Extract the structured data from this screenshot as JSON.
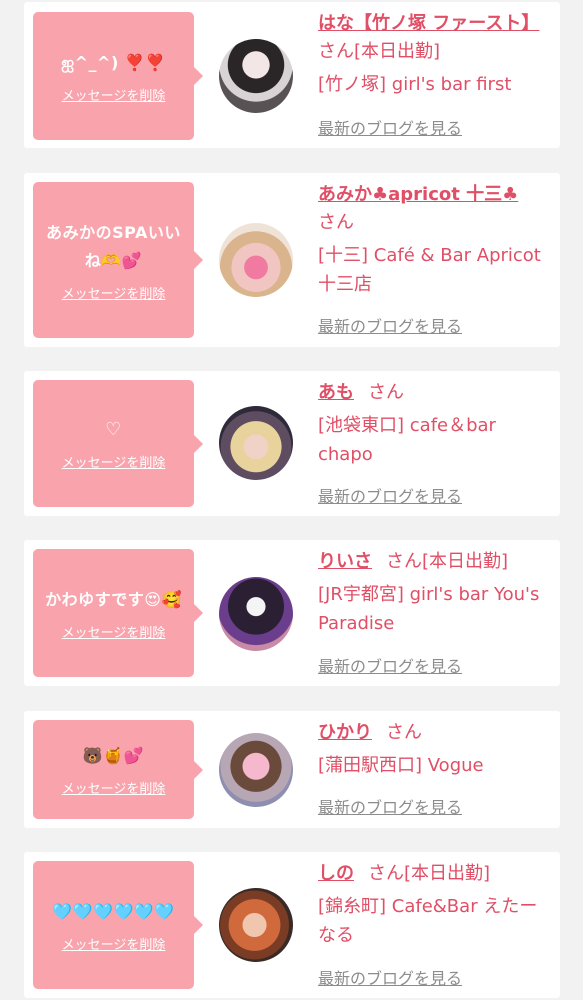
{
  "ui": {
    "delete_label": "メッセージを削除",
    "blog_label": "最新のブログを見る",
    "san": "さん",
    "accent_color": "#e04f66",
    "bubble_color": "#f9a4ad"
  },
  "cards": [
    {
      "message": "ஐ^_^) ❣️❣️",
      "name": "はな【竹ノ塚 ファースト】",
      "status": "[本日出勤]",
      "shop": "[竹ノ塚] girl's bar first"
    },
    {
      "message": "あみかのSPAいいね🫶💕",
      "name": "あみか♣apricot 十三♣",
      "status": "",
      "shop": "[十三] Café & Bar Apricot 十三店"
    },
    {
      "message": "♡",
      "name": "あも",
      "status": "",
      "shop": "[池袋東口] cafe＆bar chapo"
    },
    {
      "message": "かわゆすです😍🥰",
      "name": "りいさ",
      "status": "[本日出勤]",
      "shop": "[JR宇都宮] girl's bar You's Paradise"
    },
    {
      "message": "🐻🍯💕",
      "name": "ひかり",
      "status": "",
      "shop": "[蒲田駅西口] Vogue"
    },
    {
      "message": "🩵🩵🩵🩵🩵🩵",
      "name": "しの",
      "status": "[本日出勤]",
      "shop": "[錦糸町] Cafe&Bar えたーなる"
    }
  ]
}
